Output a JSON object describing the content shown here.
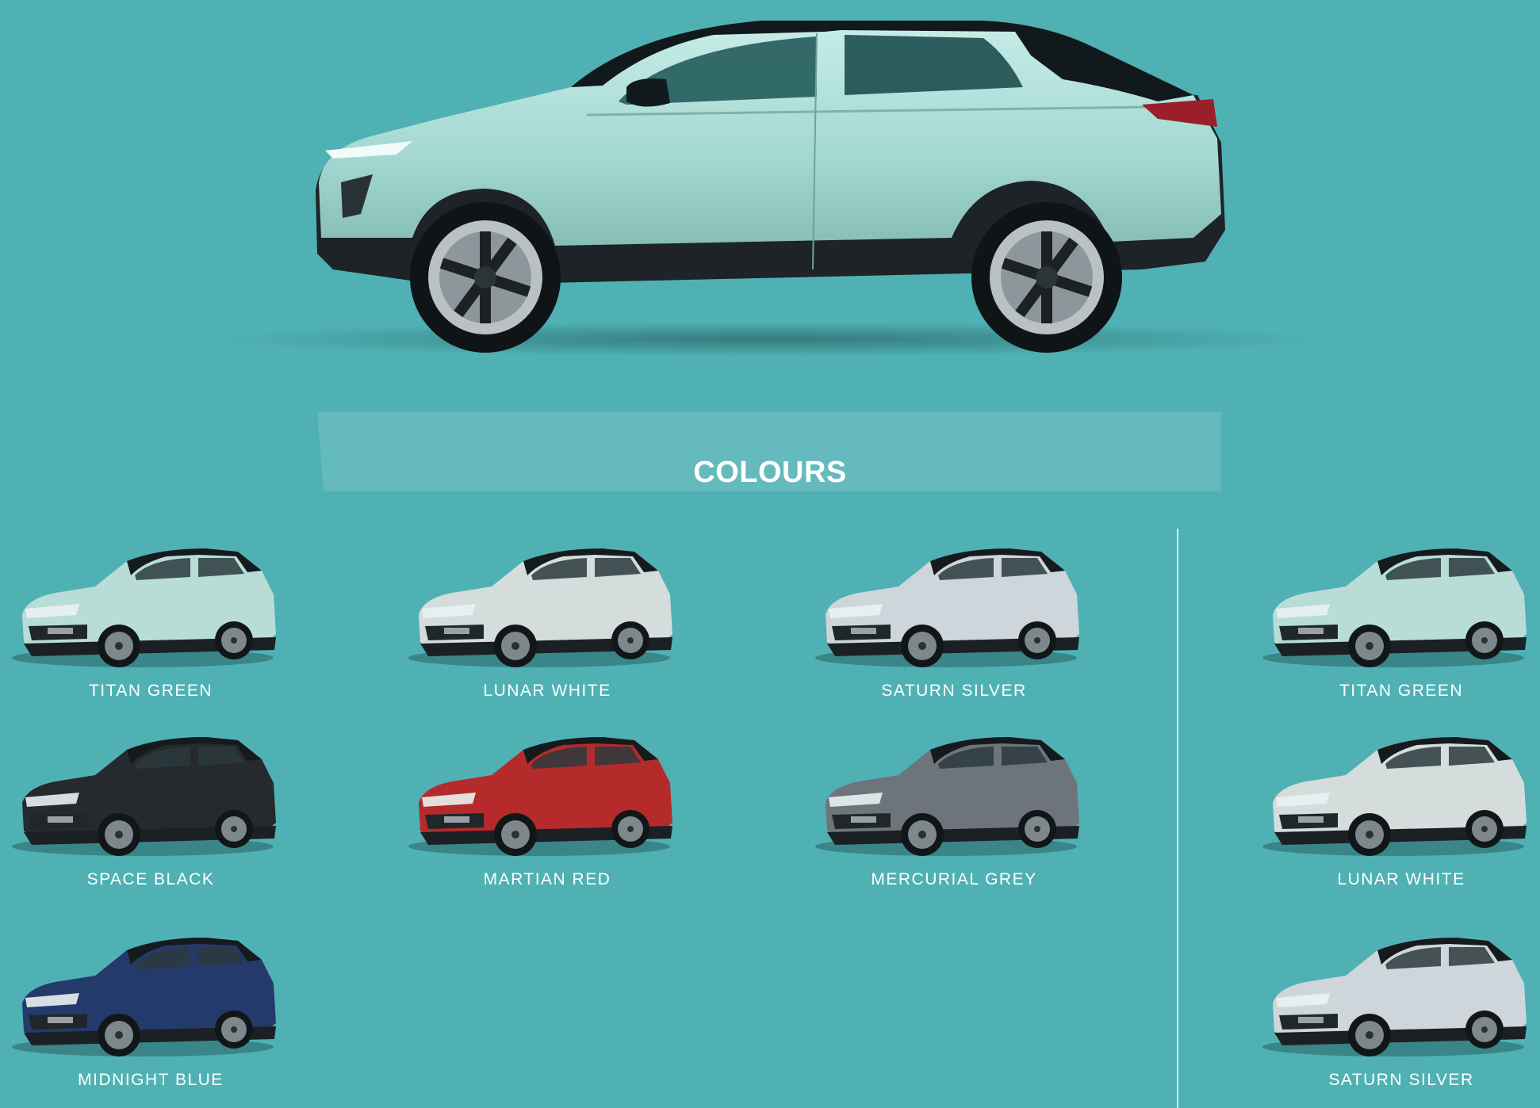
{
  "page": {
    "section_title": "COLOURS",
    "accent_background": "#4fb1b4"
  },
  "hero": {
    "image": "car-side-view-titan-green",
    "color": "#a9ddd8"
  },
  "main": {
    "swatches": [
      {
        "label": "TITAN GREEN",
        "color": "#b7ddd6"
      },
      {
        "label": "LUNAR WHITE",
        "color": "#d5dcdc"
      },
      {
        "label": "SATURN SILVER",
        "color": "#cfd6db"
      },
      {
        "label": "SPACE BLACK",
        "color": "#26292d"
      },
      {
        "label": "MARTIAN RED",
        "color": "#b52a2a"
      },
      {
        "label": "MERCURIAL GREY",
        "color": "#6e747c"
      },
      {
        "label": "MIDNIGHT BLUE",
        "color": "#243a6b"
      }
    ]
  },
  "side": {
    "swatches": [
      {
        "label": "TITAN GREEN",
        "color": "#b7ddd6"
      },
      {
        "label": "LUNAR WHITE",
        "color": "#d5dcdc"
      },
      {
        "label": "SATURN SILVER",
        "color": "#cfd6db"
      }
    ]
  }
}
